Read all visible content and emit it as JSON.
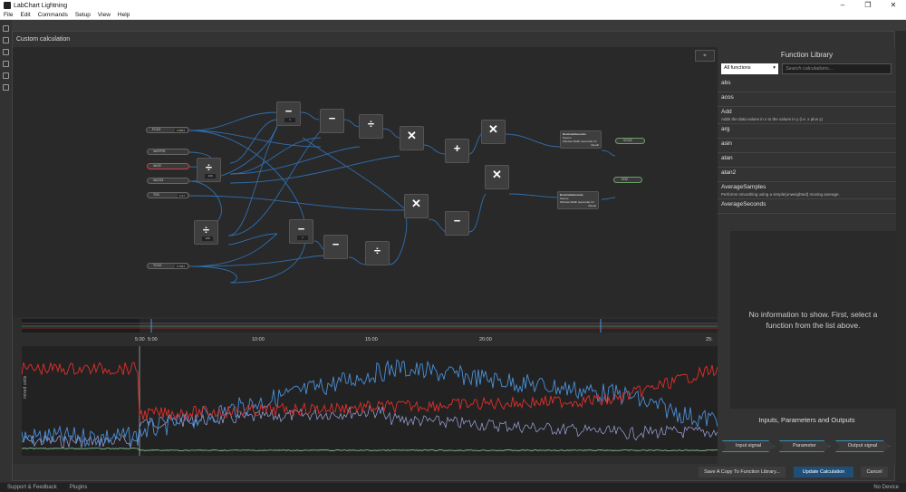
{
  "app": {
    "title": "LabChart Lightning",
    "menu": [
      "File",
      "Edit",
      "Commands",
      "Setup",
      "View",
      "Help"
    ],
    "window_buttons": [
      "–",
      "❐",
      "✕"
    ]
  },
  "dialog": {
    "title": "Custom calculation",
    "footer": {
      "save_copy": "Save A Copy To Function Library...",
      "update": "Update Calculation",
      "cancel": "Cancel"
    }
  },
  "canvas": {
    "center_icon": "crosshair-icon",
    "channels": [
      {
        "label": "FCO2",
        "value": "4.8863"
      },
      {
        "label": "VeSTPD",
        "value": ""
      },
      {
        "label": "VeO2",
        "value": ""
      },
      {
        "label": "VeCO2",
        "value": ""
      },
      {
        "label": "TO2",
        "value": "0.27"
      },
      {
        "label": "TCO2",
        "value": "0.7964"
      }
    ],
    "operator_nodes": [
      {
        "symbol": "−",
        "value": "1"
      },
      {
        "symbol": "−",
        "value": ""
      },
      {
        "symbol": "÷",
        "value": ""
      },
      {
        "symbol": "✕",
        "value": ""
      },
      {
        "symbol": "✕",
        "value": ""
      },
      {
        "symbol": "+",
        "value": ""
      },
      {
        "symbol": "÷",
        "value": "100"
      },
      {
        "symbol": "✕",
        "value": ""
      },
      {
        "symbol": "✕",
        "value": ""
      },
      {
        "symbol": "−",
        "value": ""
      },
      {
        "symbol": "÷",
        "value": "100"
      },
      {
        "symbol": "−",
        "value": "1"
      },
      {
        "symbol": "−",
        "value": ""
      },
      {
        "symbol": "÷",
        "value": ""
      }
    ],
    "function_nodes": [
      {
        "title": "DecimateSeconds",
        "source_label": "Source",
        "param_label": "Window Width (seconds)",
        "param_value": "10",
        "result_label": "Result"
      },
      {
        "title": "DecimateSeconds",
        "source_label": "Source",
        "param_label": "Window Width (seconds)",
        "param_value": "10",
        "result_label": "Result"
      }
    ],
    "outputs": [
      {
        "label": "VCO2"
      },
      {
        "label": "VO2"
      }
    ]
  },
  "preview": {
    "time_ticks": [
      "5:00",
      "5:00",
      "10:00",
      "15:00",
      "20:00",
      "25:"
    ],
    "y_axis_label": "mixed units",
    "colors": {
      "blue": "#4a90d9",
      "red": "#e0302b",
      "lavender": "#a0a8e0",
      "green": "#8fd19e"
    }
  },
  "function_library": {
    "title": "Function Library",
    "filter_selected": "All functions",
    "search_placeholder": "Search calculations...",
    "items": [
      {
        "name": "abs",
        "desc": ""
      },
      {
        "name": "acos",
        "desc": ""
      },
      {
        "name": "Add",
        "desc": "Adds the data values in x to the values in y (i.e. x plus y)"
      },
      {
        "name": "arg",
        "desc": ""
      },
      {
        "name": "asin",
        "desc": ""
      },
      {
        "name": "atan",
        "desc": ""
      },
      {
        "name": "atan2",
        "desc": ""
      },
      {
        "name": "AverageSamples",
        "desc": "Performs smoothing using a simple(unweighted) moving average."
      },
      {
        "name": "AverageSeconds",
        "desc": ""
      }
    ],
    "info_message": "No information to show. First, select a function from the list above.",
    "ipo_title": "Inputs, Parameters and Outputs",
    "ipo_buttons": [
      "Input signal",
      "Parameter",
      "Output signal"
    ]
  },
  "statusbar": {
    "support": "Support & Feedback",
    "plugins": "Plugins",
    "device": "No Device"
  }
}
